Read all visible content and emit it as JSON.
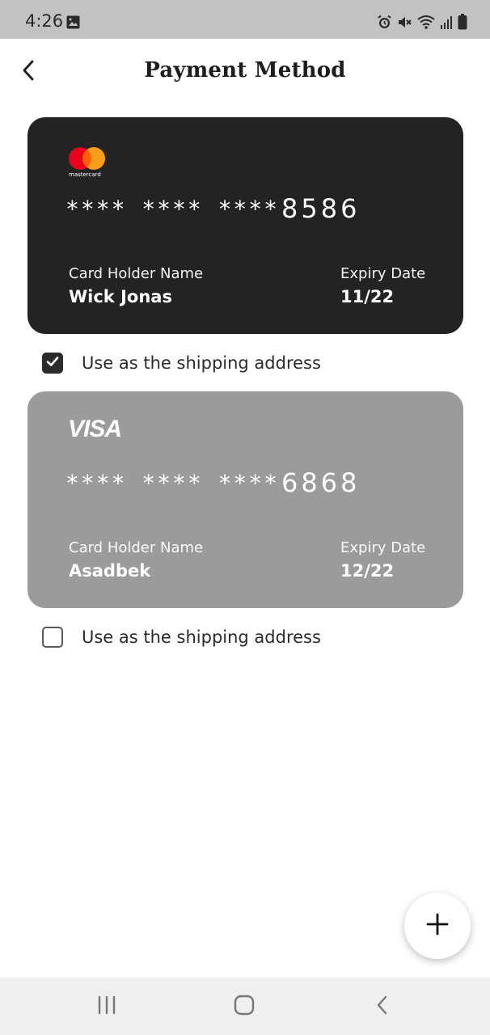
{
  "status_bar": {
    "time": "4:26",
    "icons": [
      "image-icon",
      "alarm-icon",
      "mute-icon",
      "wifi-icon",
      "signal-icon",
      "battery-icon"
    ]
  },
  "header": {
    "title": "Payment Method",
    "back_icon": "chevron-left-icon"
  },
  "cards": [
    {
      "brand": "mastercard",
      "brand_text": "mastercard",
      "masked": "**** **** ****",
      "last4": "8586",
      "holder_label": "Card Holder Name",
      "holder_name": "Wick Jonas",
      "expiry_label": "Expiry Date",
      "expiry": "11/22",
      "background": "#232323",
      "shipping_label": "Use as the shipping address",
      "shipping_checked": true
    },
    {
      "brand": "visa",
      "brand_text": "VISA",
      "masked": "**** **** ****",
      "last4": "6868",
      "holder_label": "Card Holder Name",
      "holder_name": "Asadbek",
      "expiry_label": "Expiry Date",
      "expiry": "12/22",
      "background": "#9b9b9b",
      "shipping_label": "Use as the shipping address",
      "shipping_checked": false
    }
  ],
  "fab": {
    "icon": "plus-icon"
  },
  "nav_bar": {
    "icons": [
      "recents-icon",
      "home-icon",
      "back-icon"
    ]
  },
  "colors": {
    "status_bar_bg": "#c2c2c2",
    "mastercard_red": "#eb001b",
    "mastercard_orange": "#f79e1b",
    "checkbox_checked": "#2b2b2b"
  }
}
